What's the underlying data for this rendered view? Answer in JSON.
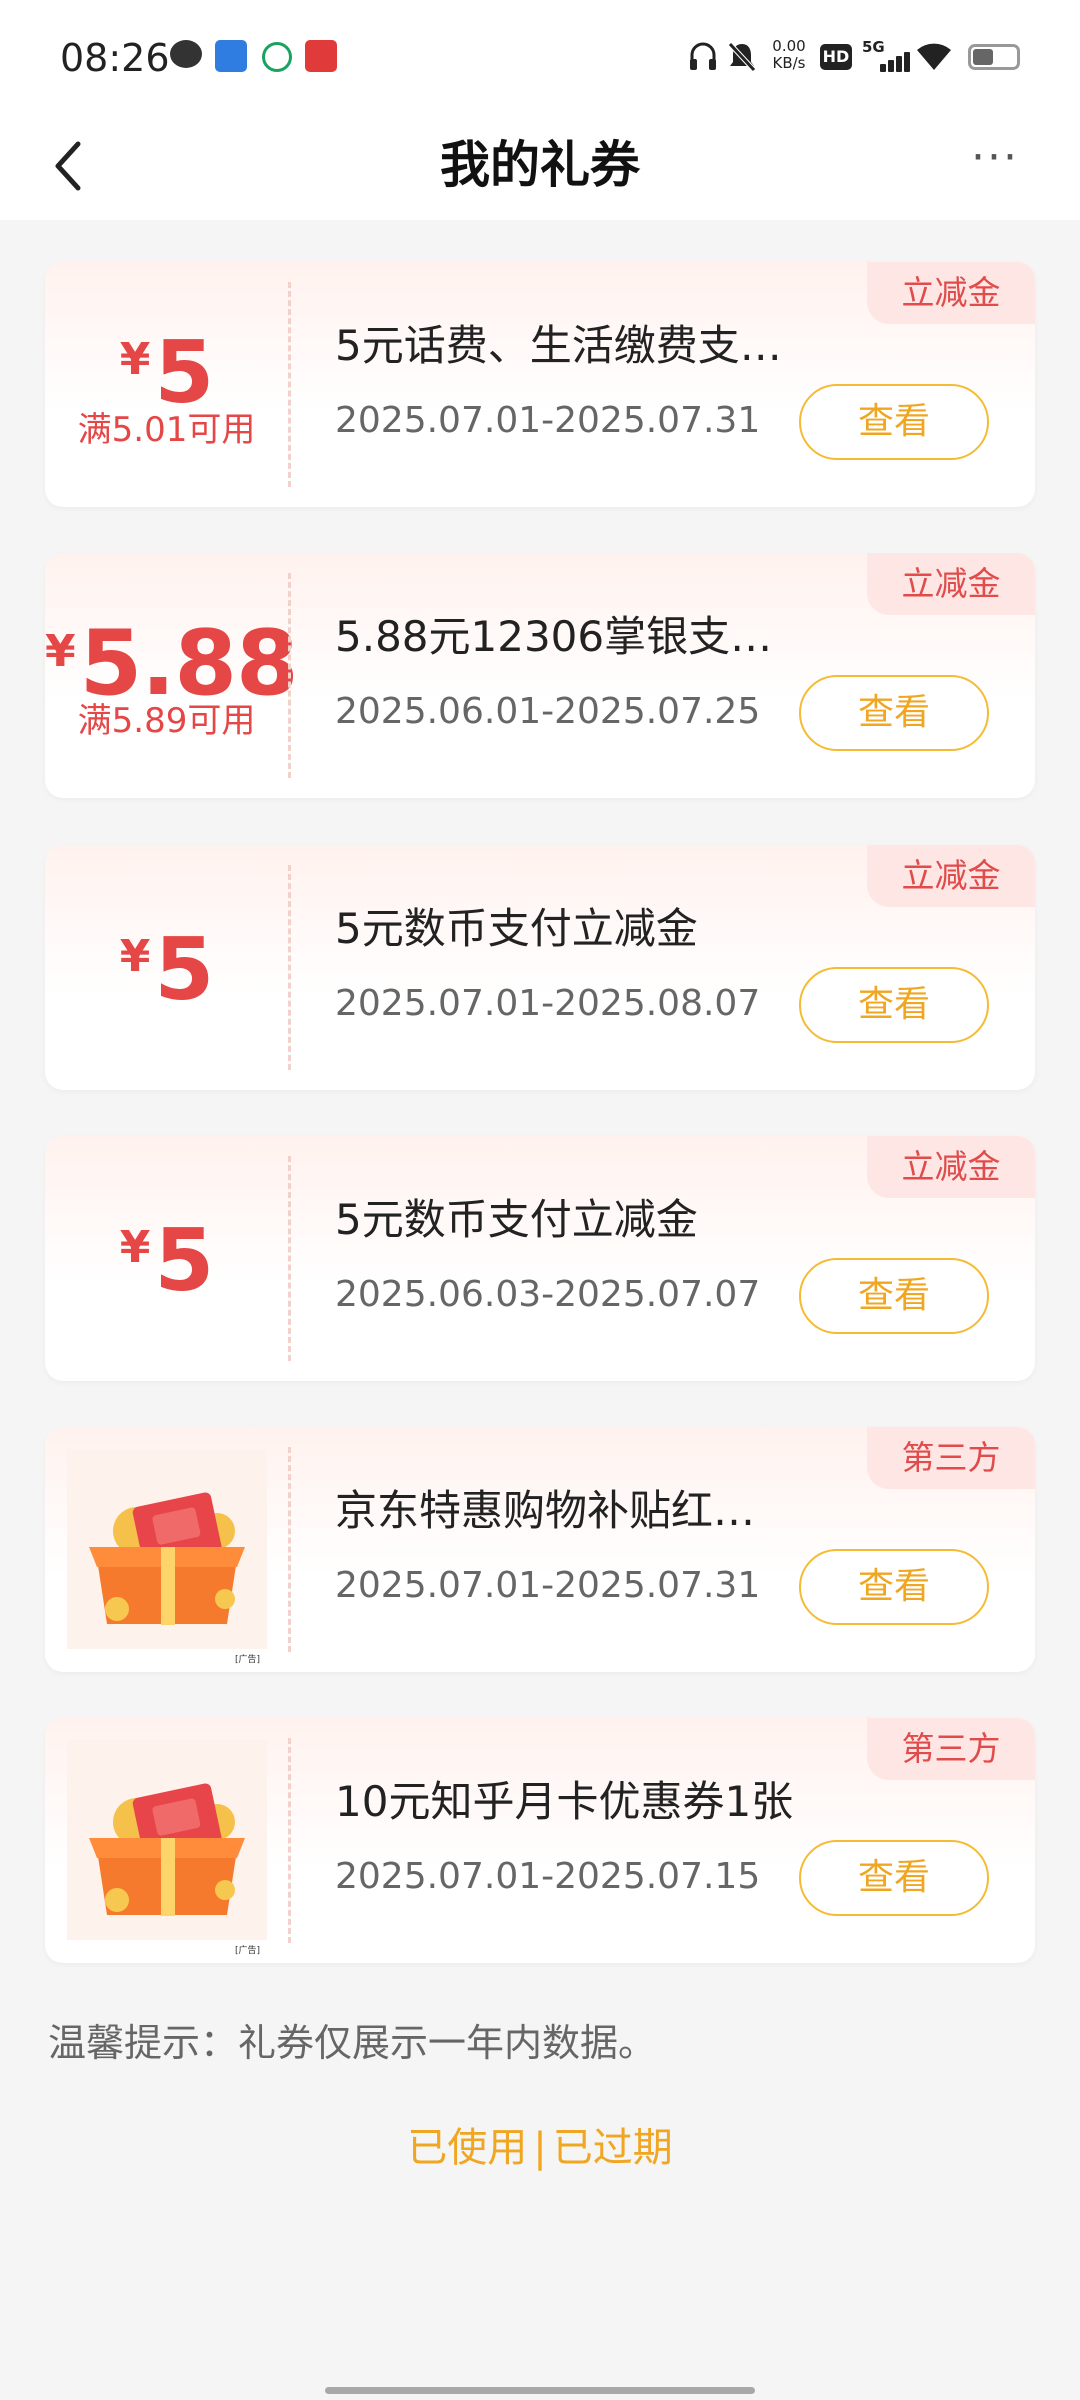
{
  "status_bar": {
    "time": "08:26",
    "speed_value": "0.00",
    "speed_unit": "KB/s",
    "hd": "HD",
    "network": "5G"
  },
  "header": {
    "title": "我的礼券",
    "back_icon": "chevron-left-icon",
    "more_icon": "more-dots-icon",
    "more_label": "···"
  },
  "coupons": [
    {
      "tag": "立减金",
      "currency": "¥",
      "amount": "5",
      "condition": "满5.01可用",
      "title": "5元话费、生活缴费支…",
      "date_range": "2025.07.01-2025.07.31",
      "button": "查看"
    },
    {
      "tag": "立减金",
      "currency": "¥",
      "amount": "5.88",
      "condition": "满5.89可用",
      "title": "5.88元12306掌银支…",
      "date_range": "2025.06.01-2025.07.25",
      "button": "查看"
    },
    {
      "tag": "立减金",
      "currency": "¥",
      "amount": "5",
      "title": "5元数币支付立减金",
      "date_range": "2025.07.01-2025.08.07",
      "button": "查看"
    },
    {
      "tag": "立减金",
      "currency": "¥",
      "amount": "5",
      "title": "5元数币支付立减金",
      "date_range": "2025.06.03-2025.07.07",
      "button": "查看"
    },
    {
      "tag": "第三方",
      "image": "gift-box-icon",
      "ad_label": "[广告]",
      "title": "京东特惠购物补贴红…",
      "date_range": "2025.07.01-2025.07.31",
      "button": "查看"
    },
    {
      "tag": "第三方",
      "image": "gift-box-icon",
      "ad_label": "[广告]",
      "title": "10元知乎月卡优惠券1张",
      "date_range": "2025.07.01-2025.07.15",
      "button": "查看"
    }
  ],
  "tip": "温馨提示：礼券仅展示一年内数据。",
  "bottom_links": {
    "used": "已使用",
    "separator": "|",
    "expired": "已过期"
  }
}
